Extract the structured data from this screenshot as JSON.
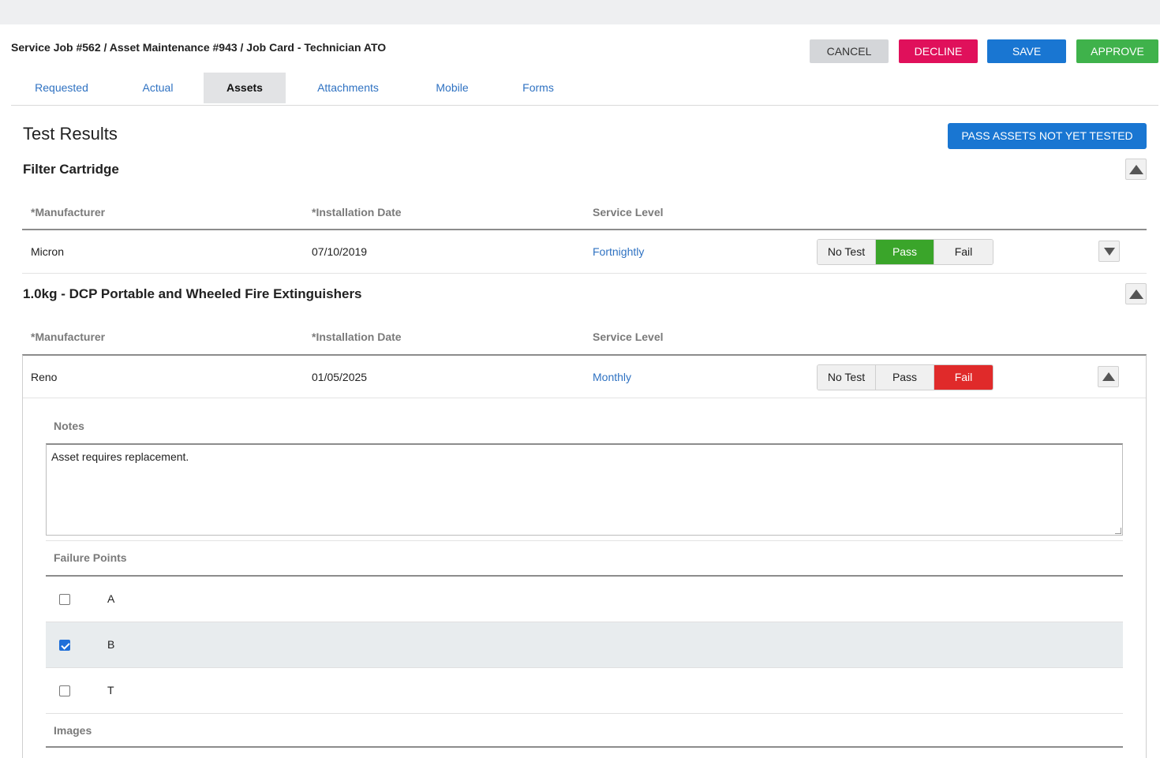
{
  "header": {
    "breadcrumb": "Service Job #562 / Asset Maintenance #943 / Job Card - Technician ATO"
  },
  "actions": {
    "cancel": "CANCEL",
    "decline": "DECLINE",
    "save": "SAVE",
    "approve": "APPROVE"
  },
  "tabs": [
    {
      "label": "Requested",
      "active": false
    },
    {
      "label": "Actual",
      "active": false
    },
    {
      "label": "Assets",
      "active": true
    },
    {
      "label": "Attachments",
      "active": false
    },
    {
      "label": "Mobile",
      "active": false
    },
    {
      "label": "Forms",
      "active": false
    }
  ],
  "test_results": {
    "title": "Test Results",
    "pass_all_button": "PASS ASSETS NOT YET TESTED"
  },
  "columns": {
    "manufacturer": "*Manufacturer",
    "installation_date": "*Installation Date",
    "service_level": "Service Level"
  },
  "test_options": [
    "No Test",
    "Pass",
    "Fail"
  ],
  "assets": [
    {
      "title": "Filter Cartridge",
      "manufacturer": "Micron",
      "installation_date": "07/10/2019",
      "service_level": "Fortnightly",
      "result": "Pass"
    },
    {
      "title": "1.0kg - DCP Portable and Wheeled Fire Extinguishers",
      "manufacturer": "Reno",
      "installation_date": "01/05/2025",
      "service_level": "Monthly",
      "result": "Fail",
      "details": {
        "notes_label": "Notes",
        "notes_value": "Asset requires replacement.",
        "failure_points_label": "Failure Points",
        "failure_points": [
          {
            "label": "A",
            "checked": false
          },
          {
            "label": "B",
            "checked": true
          },
          {
            "label": "T",
            "checked": false
          }
        ],
        "images_label": "Images"
      }
    }
  ],
  "colors": {
    "primary": "#1976d2",
    "decline": "#e0105b",
    "approve": "#3fb24b",
    "pass_on": "#3aa52a",
    "fail_on": "#e02a2a",
    "link": "#2f72c2"
  }
}
